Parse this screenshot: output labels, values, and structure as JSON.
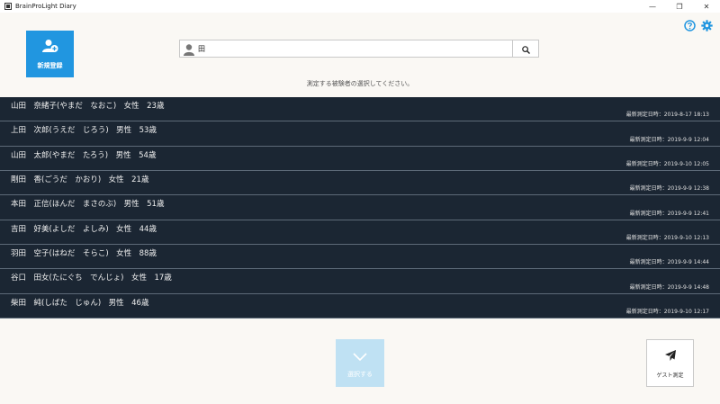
{
  "window": {
    "title": "BrainProLight Diary",
    "minimize": "—",
    "maximize": "❐",
    "close": "✕"
  },
  "header": {
    "new_registration_label": "新規登録",
    "search_value": "田",
    "instruction": "測定する被験者の選択してください。"
  },
  "subjects": [
    {
      "name": "山田　奈緒子(やまだ　なおこ)　女性　23歳",
      "last_measured": "最新測定日時：2019-8-17 18:13"
    },
    {
      "name": "上田　次郎(うえだ　じろう)　男性　53歳",
      "last_measured": "最新測定日時：2019-9-9 12:04"
    },
    {
      "name": "山田　太郎(やまだ　たろう)　男性　54歳",
      "last_measured": "最新測定日時：2019-9-10 12:05"
    },
    {
      "name": "剛田　香(ごうだ　かおり)　女性　21歳",
      "last_measured": "最新測定日時：2019-9-9 12:38"
    },
    {
      "name": "本田　正信(ほんだ　まさのぶ)　男性　51歳",
      "last_measured": "最新測定日時：2019-9-9 12:41"
    },
    {
      "name": "吉田　好美(よしだ　よしみ)　女性　44歳",
      "last_measured": "最新測定日時：2019-9-10 12:13"
    },
    {
      "name": "羽田　空子(はねだ　そらこ)　女性　88歳",
      "last_measured": "最新測定日時：2019-9-9 14:44"
    },
    {
      "name": "谷口　田女(たにぐち　でんじょ)　女性　17歳",
      "last_measured": "最新測定日時：2019-9-9 14:48"
    },
    {
      "name": "柴田　純(しばた　じゅん)　男性　46歳",
      "last_measured": "最新測定日時：2019-9-10 12:17"
    }
  ],
  "footer": {
    "select_label": "選択する",
    "guest_label": "ゲスト測定"
  },
  "colors": {
    "accent": "#2196e0",
    "list_bg": "#1b2633",
    "select_disabled": "#bfe1f3",
    "background": "#faf8f4"
  },
  "icons": [
    "app-icon",
    "add-user-icon",
    "help-icon",
    "gear-icon",
    "user-icon",
    "search-icon",
    "chevron-down-icon",
    "paper-plane-icon"
  ]
}
